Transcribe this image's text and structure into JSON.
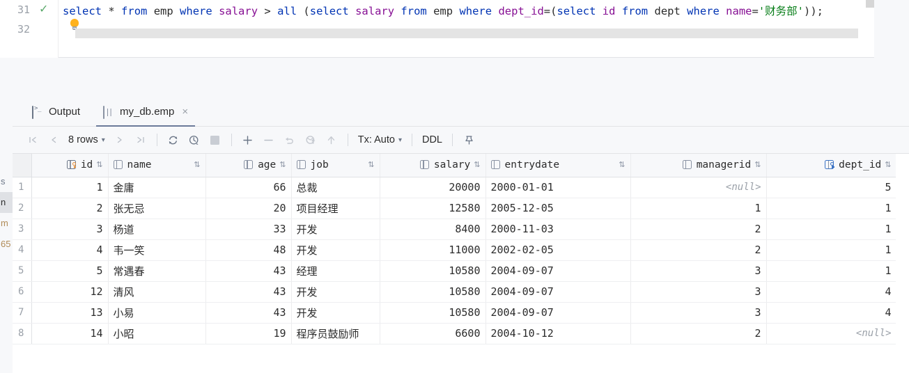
{
  "editor": {
    "line_numbers": [
      "31",
      "32"
    ],
    "status_icon": "checkmark-icon",
    "hint_icon": "lightbulb-icon",
    "sql_tokens": [
      {
        "t": "select",
        "c": "kw"
      },
      {
        "t": " ",
        "c": "op"
      },
      {
        "t": "*",
        "c": "op"
      },
      {
        "t": " ",
        "c": "op"
      },
      {
        "t": "from",
        "c": "kw"
      },
      {
        "t": " ",
        "c": "op"
      },
      {
        "t": "emp",
        "c": "tbl"
      },
      {
        "t": " ",
        "c": "op"
      },
      {
        "t": "where",
        "c": "kw"
      },
      {
        "t": " ",
        "c": "op"
      },
      {
        "t": "salary",
        "c": "col"
      },
      {
        "t": " > ",
        "c": "op"
      },
      {
        "t": "all",
        "c": "kw"
      },
      {
        "t": " (",
        "c": "op"
      },
      {
        "t": "select",
        "c": "kw"
      },
      {
        "t": " ",
        "c": "op"
      },
      {
        "t": "salary",
        "c": "col"
      },
      {
        "t": " ",
        "c": "op"
      },
      {
        "t": "from",
        "c": "kw"
      },
      {
        "t": " ",
        "c": "op"
      },
      {
        "t": "emp",
        "c": "tbl"
      },
      {
        "t": " ",
        "c": "op"
      },
      {
        "t": "where",
        "c": "kw"
      },
      {
        "t": " ",
        "c": "op"
      },
      {
        "t": "dept_id",
        "c": "col"
      },
      {
        "t": "=(",
        "c": "op"
      },
      {
        "t": "select",
        "c": "kw"
      },
      {
        "t": " ",
        "c": "op"
      },
      {
        "t": "id",
        "c": "col"
      },
      {
        "t": " ",
        "c": "op"
      },
      {
        "t": "from",
        "c": "kw"
      },
      {
        "t": " ",
        "c": "op"
      },
      {
        "t": "dept",
        "c": "tbl"
      },
      {
        "t": " ",
        "c": "op"
      },
      {
        "t": "where",
        "c": "kw"
      },
      {
        "t": " ",
        "c": "op"
      },
      {
        "t": "name",
        "c": "col"
      },
      {
        "t": "=",
        "c": "op"
      },
      {
        "t": "'财务部'",
        "c": "str"
      },
      {
        "t": "));",
        "c": "op"
      }
    ],
    "sql_text": "select * from emp where salary > all (select salary from emp where dept_id=(select id from dept where name='财务部'));"
  },
  "sidebar_sliver": {
    "rows": [
      "s",
      "n",
      "m",
      "65"
    ]
  },
  "tabs": [
    {
      "label": "Output",
      "icon": "console-icon",
      "active": false,
      "closable": false
    },
    {
      "label": "my_db.emp",
      "icon": "table-grid-icon",
      "active": true,
      "closable": true,
      "close_label": "×"
    }
  ],
  "toolbar": {
    "first_page": "❘‹",
    "prev_page": "‹",
    "rows_label": "8 rows",
    "rows_caret": "⌄",
    "next_page": "›",
    "last_page": "›❘",
    "reload_icon": "refresh-icon",
    "history_icon": "clock-history-icon",
    "stop_icon": "stop-icon",
    "add_row": "+",
    "delete_row": "−",
    "revert_icon": "undo-icon",
    "rollback_icon": "revert-changes-icon",
    "submit_icon": "upload-arrow-icon",
    "tx_label": "Tx: Auto",
    "tx_caret": "⌄",
    "ddl_label": "DDL",
    "pin_icon": "pin-icon"
  },
  "grid": {
    "sort_glyph": "⇅",
    "columns": [
      {
        "name": "id",
        "icon": "column-primary-key-icon",
        "align": "right",
        "key": "pk"
      },
      {
        "name": "name",
        "icon": "column-icon",
        "align": "left",
        "key": "none"
      },
      {
        "name": "age",
        "icon": "column-icon",
        "align": "right",
        "key": "none"
      },
      {
        "name": "job",
        "icon": "column-icon",
        "align": "left",
        "key": "none"
      },
      {
        "name": "salary",
        "icon": "column-icon",
        "align": "right",
        "key": "none"
      },
      {
        "name": "entrydate",
        "icon": "column-icon",
        "align": "left",
        "key": "none"
      },
      {
        "name": "managerid",
        "icon": "column-icon",
        "align": "right",
        "key": "none"
      },
      {
        "name": "dept_id",
        "icon": "column-foreign-key-icon",
        "align": "right",
        "key": "fk"
      }
    ],
    "null_text": "<null>",
    "rows": [
      {
        "n": "1",
        "id": "1",
        "name": "金庸",
        "age": "66",
        "job": "总裁",
        "salary": "20000",
        "entrydate": "2000-01-01",
        "managerid": "<null>",
        "dept_id": "5"
      },
      {
        "n": "2",
        "id": "2",
        "name": "张无忌",
        "age": "20",
        "job": "项目经理",
        "salary": "12580",
        "entrydate": "2005-12-05",
        "managerid": "1",
        "dept_id": "1"
      },
      {
        "n": "3",
        "id": "3",
        "name": "杨道",
        "age": "33",
        "job": "开发",
        "salary": "8400",
        "entrydate": "2000-11-03",
        "managerid": "2",
        "dept_id": "1"
      },
      {
        "n": "4",
        "id": "4",
        "name": "韦一笑",
        "age": "48",
        "job": "开发",
        "salary": "11000",
        "entrydate": "2002-02-05",
        "managerid": "2",
        "dept_id": "1"
      },
      {
        "n": "5",
        "id": "5",
        "name": "常遇春",
        "age": "43",
        "job": "经理",
        "salary": "10580",
        "entrydate": "2004-09-07",
        "managerid": "3",
        "dept_id": "1"
      },
      {
        "n": "6",
        "id": "12",
        "name": "清风",
        "age": "43",
        "job": "开发",
        "salary": "10580",
        "entrydate": "2004-09-07",
        "managerid": "3",
        "dept_id": "4"
      },
      {
        "n": "7",
        "id": "13",
        "name": "小易",
        "age": "43",
        "job": "开发",
        "salary": "10580",
        "entrydate": "2004-09-07",
        "managerid": "3",
        "dept_id": "4"
      },
      {
        "n": "8",
        "id": "14",
        "name": "小昭",
        "age": "19",
        "job": "程序员鼓励师",
        "salary": "6600",
        "entrydate": "2004-10-12",
        "managerid": "2",
        "dept_id": "<null>"
      }
    ]
  },
  "colors": {
    "keyword": "#0033b3",
    "column": "#871094",
    "string": "#067d17",
    "pk_key": "#e8913a",
    "fk_key": "#3b73c4",
    "ok_check": "#59a869",
    "panel_bg": "#f7f8fa"
  }
}
